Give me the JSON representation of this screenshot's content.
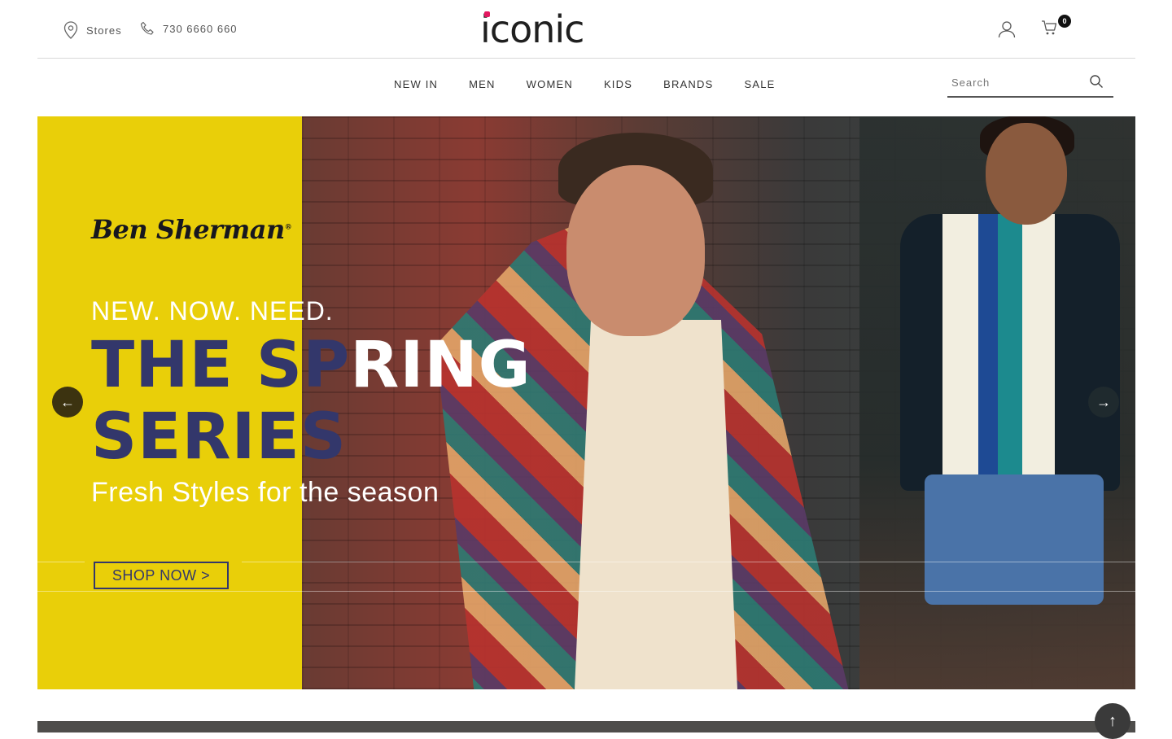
{
  "header": {
    "stores_label": "Stores",
    "phone": "730 6660 660",
    "logo_text": "iconic",
    "cart_count": "0",
    "icons": {
      "stores": "location-pin-icon",
      "phone": "phone-icon",
      "account": "user-icon",
      "cart": "cart-icon",
      "search": "search-icon"
    },
    "accent": "#e3175f"
  },
  "nav": {
    "items": [
      {
        "label": "NEW IN"
      },
      {
        "label": "MEN"
      },
      {
        "label": "WOMEN"
      },
      {
        "label": "KIDS"
      },
      {
        "label": "BRANDS"
      },
      {
        "label": "SALE"
      }
    ]
  },
  "search": {
    "placeholder": "Search",
    "value": ""
  },
  "hero": {
    "brand_name": "Ben Sherman",
    "brand_mark": "®",
    "tagline": "NEW. NOW. NEED.",
    "headline_line1_part1": "THE SP",
    "headline_line1_part2": "RING",
    "headline_line2": "SERIES",
    "subtitle": "Fresh Styles for the season",
    "cta_label": "SHOP NOW  >",
    "prev_label": "←",
    "next_label": "→",
    "panel_color": "#e9cf09",
    "headline_color": "#33376b"
  },
  "scroll_top_label": "↑"
}
